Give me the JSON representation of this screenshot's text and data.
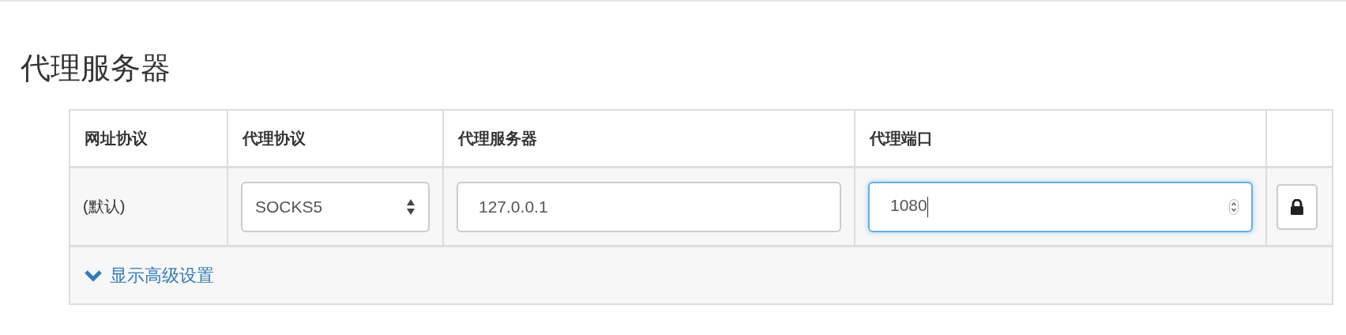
{
  "section_title": "代理服务器",
  "table": {
    "columns": [
      "网址协议",
      "代理协议",
      "代理服务器",
      "代理端口"
    ],
    "rows": [
      {
        "scheme": "(默认)",
        "protocol": {
          "value": "SOCKS5"
        },
        "server": {
          "value": "127.0.0.1",
          "focused": false
        },
        "port": {
          "value": "1080",
          "focused": true
        },
        "lock": {
          "locked": true
        }
      }
    ],
    "advanced_link": {
      "label": "显示高级设置",
      "expanded": false
    }
  }
}
